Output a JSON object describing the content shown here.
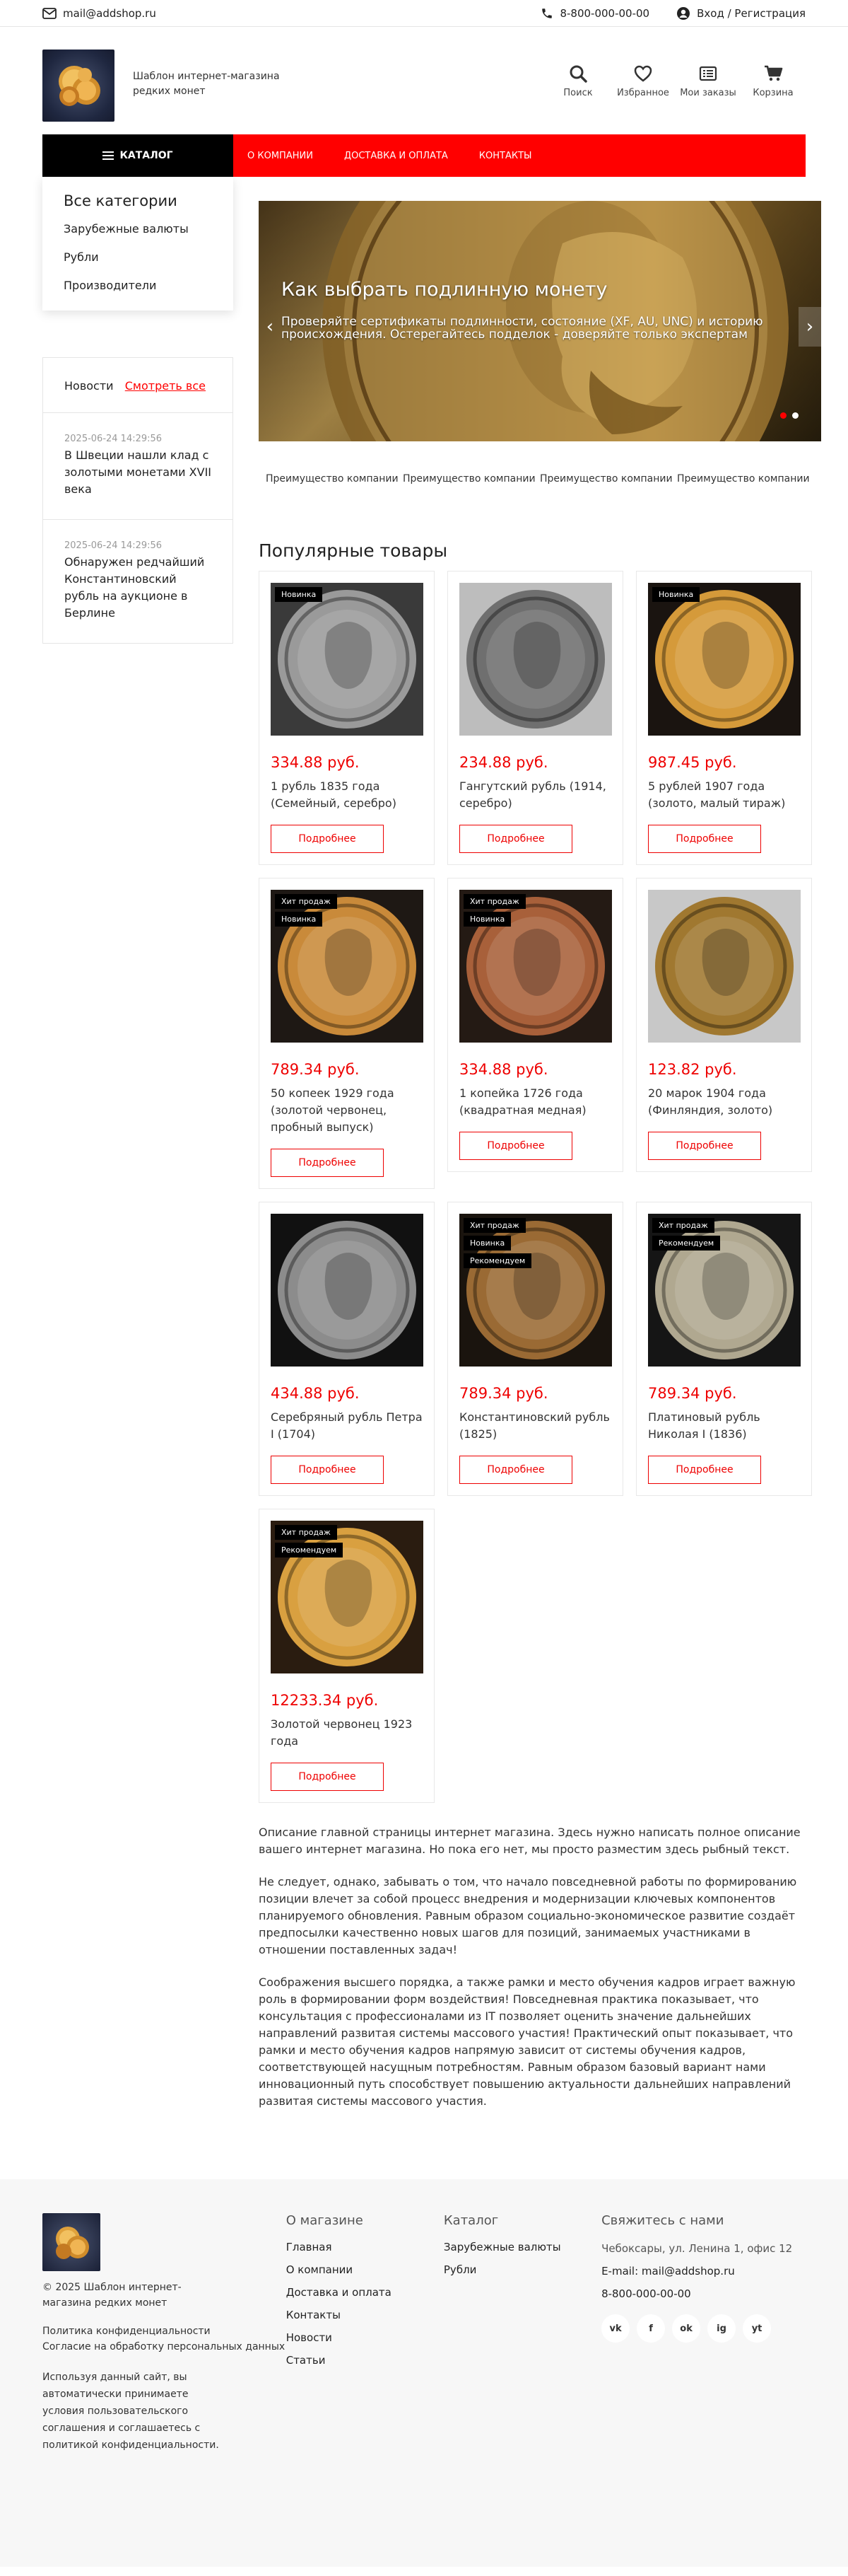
{
  "topbar": {
    "email": "mail@addshop.ru",
    "phone": "8-800-000-00-00",
    "account": "Вход / Регистрация"
  },
  "header": {
    "logo_text": "Шаблон интернет-магазина редких монет",
    "icons": [
      {
        "label": "Поиск",
        "icon": "search-icon"
      },
      {
        "label": "Избранное",
        "icon": "heart-icon"
      },
      {
        "label": "Мои заказы",
        "icon": "orders-icon"
      },
      {
        "label": "Корзина",
        "icon": "cart-icon"
      }
    ]
  },
  "nav": {
    "catalog": "КАТАЛОГ",
    "menu": [
      "О КОМПАНИИ",
      "ДОСТАВКА И ОПЛАТА",
      "КОНТАКТЫ"
    ]
  },
  "sidebar": {
    "title": "Все категории",
    "categories": [
      "Зарубежные валюты",
      "Рубли",
      "Производители"
    ],
    "news_title": "Новости",
    "news_all": "Смотреть все",
    "news": [
      {
        "date": "2025-06-24 14:29:56",
        "title": "В Швеции нашли клад с золотыми монетами XVII века"
      },
      {
        "date": "2025-06-24 14:29:56",
        "title": "Обнаружен редчайший Константиновский рубль на аукционе в Берлине"
      }
    ]
  },
  "slider": {
    "title": "Как выбрать подлинную монету",
    "text": "Проверяйте сертификаты подлинности, состояние (XF, AU, UNC) и историю происхождения. Остерегайтесь подделок - доверяйте только экспертам"
  },
  "advantages": [
    "Преимущество компании",
    "Преимущество компании",
    "Преимущество компании",
    "Преимущество компании"
  ],
  "popular_title": "Популярные товары",
  "more_label": "Подробнее",
  "products": [
    {
      "price": "334.88 руб.",
      "name": "1 рубль 1835 года (Семейный, серебро)",
      "badges": [
        "Новинка"
      ]
    },
    {
      "price": "234.88 руб.",
      "name": "Гангутский рубль (1914, серебро)",
      "badges": []
    },
    {
      "price": "987.45 руб.",
      "name": "5 рублей 1907 года (золото, малый тираж)",
      "badges": [
        "Новинка"
      ]
    },
    {
      "price": "789.34 руб.",
      "name": "50 копеек 1929 года (золотой червонец, пробный выпуск)",
      "badges": [
        "Хит продаж",
        "Новинка"
      ]
    },
    {
      "price": "334.88 руб.",
      "name": "1 копейка 1726 года (квадратная медная)",
      "badges": [
        "Хит продаж",
        "Новинка"
      ]
    },
    {
      "price": "123.82 руб.",
      "name": "20 марок 1904 года (Финляндия, золото)",
      "badges": []
    },
    {
      "price": "434.88 руб.",
      "name": "Серебряный рубль Петра I (1704)",
      "badges": []
    },
    {
      "price": "789.34 руб.",
      "name": "Константиновский рубль (1825)",
      "badges": [
        "Хит продаж",
        "Новинка",
        "Рекомендуем"
      ]
    },
    {
      "price": "789.34 руб.",
      "name": "Платиновый рубль Николая I (1836)",
      "badges": [
        "Хит продаж",
        "Рекомендуем"
      ]
    },
    {
      "price": "12233.34 руб.",
      "name": "Золотой червонец 1923 года",
      "badges": [
        "Хит продаж",
        "Рекомендуем"
      ]
    }
  ],
  "description": [
    "Описание главной страницы интернет магазина. Здесь нужно написать полное описание вашего интернет магазина. Но пока его нет, мы просто разместим здесь рыбный текст.",
    "Не следует, однако, забывать о том, что начало повседневной работы по формированию позиции влечет за собой процесс внедрения и модернизации ключевых компонентов планируемого обновления. Равным образом социально-экономическое развитие создаёт предпосылки качественно новых шагов для позиций, занимаемых участниками в отношении поставленных задач!",
    "Соображения высшего порядка, а также рамки и место обучения кадров играет важную роль в формировании форм воздействия! Повседневная практика показывает, что консультация с профессионалами из IT позволяет оценить значение дальнейших направлений развитая системы массового участия! Практический опыт показывает, что рамки и место обучения кадров напрямую зависит от системы обучения кадров, соответствующей насущным потребностям. Равным образом базовый вариант нами инновационный путь способствует повышению актуальности дальнейших направлений развитая системы массового участия."
  ],
  "footer": {
    "copyright": "© 2025 Шаблон интернет-магазина редких монет",
    "policy": "Политика конфиденциальности",
    "consent": "Согласие на обработку персональных данных",
    "cookie_note": "Используя данный сайт, вы автоматически принимаете условия пользовательского соглашения и соглашаетесь с политикой конфиденциальности.",
    "about_title": "О магазине",
    "about": [
      "Главная",
      "О компании",
      "Доставка и оплата",
      "Контакты",
      "Новости",
      "Статьи"
    ],
    "catalog_title": "Каталог",
    "catalog": [
      "Зарубежные валюты",
      "Рубли"
    ],
    "contact_title": "Свяжитесь с нами",
    "address": "Чебоксары, ул. Ленина 1, офис 12",
    "email": "E-mail: mail@addshop.ru",
    "phone": "8-800-000-00-00",
    "socials": [
      {
        "icon": "vk-icon",
        "label": "vk"
      },
      {
        "icon": "facebook-icon",
        "label": "f"
      },
      {
        "icon": "ok-icon",
        "label": "ok"
      },
      {
        "icon": "instagram-icon",
        "label": "ig"
      },
      {
        "icon": "youtube-icon",
        "label": "yt"
      }
    ]
  },
  "colors": {
    "accent": "#ff0000",
    "dark": "#000000",
    "price": "#e00000"
  }
}
